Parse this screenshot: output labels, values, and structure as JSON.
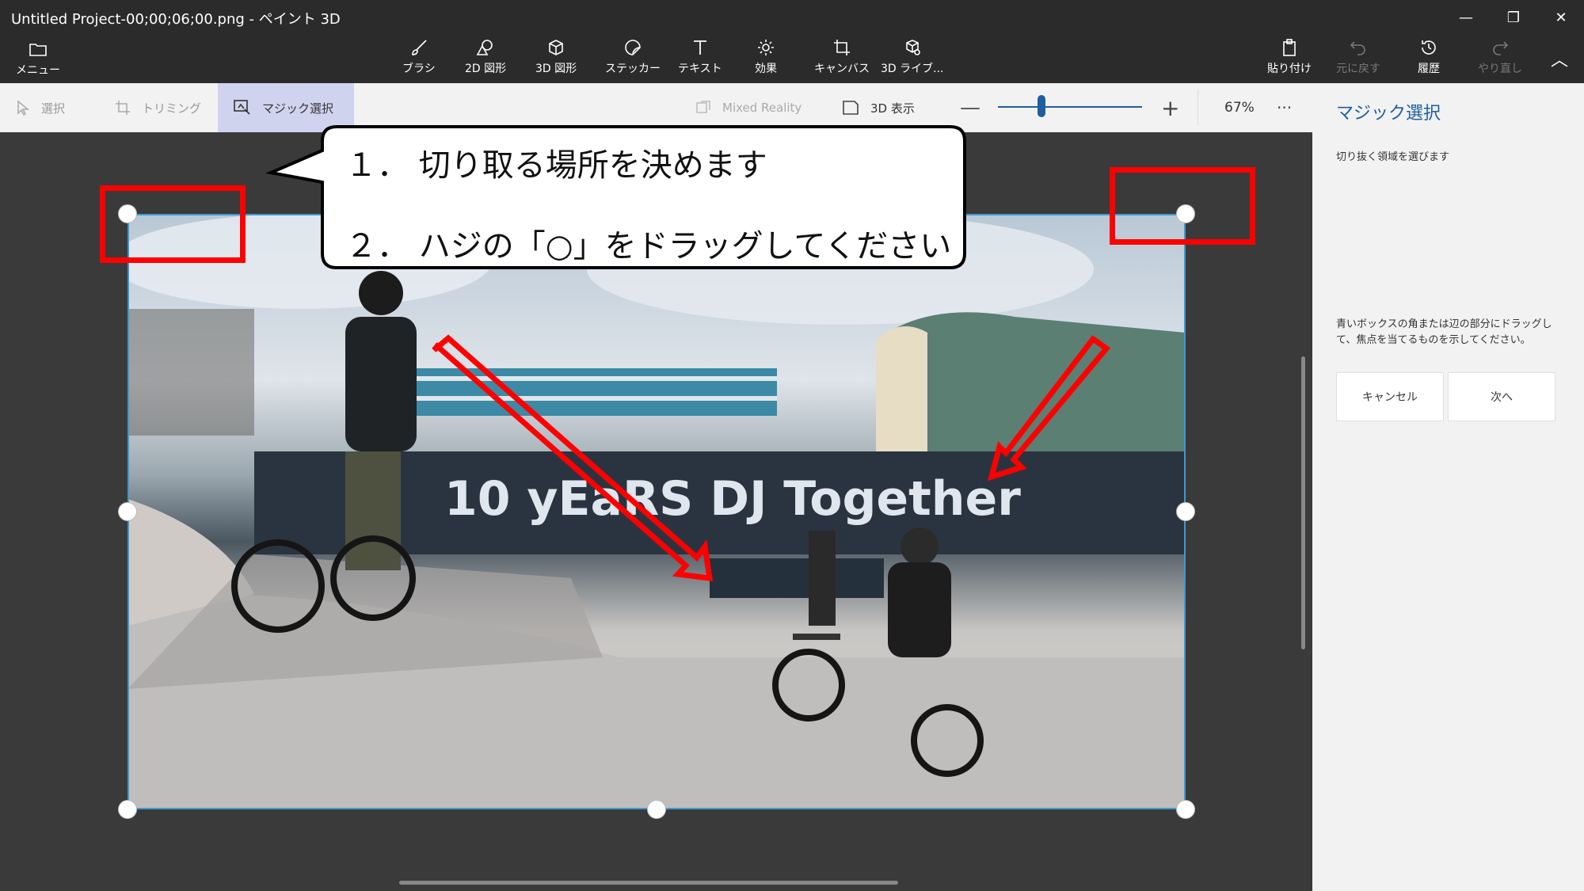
{
  "window": {
    "title": "Untitled Project-00;00;06;00.png - ペイント 3D",
    "minimize": "—",
    "restore": "❐",
    "close": "✕"
  },
  "ribbon": {
    "menu": "メニュー",
    "tools": [
      {
        "label": "ブラシ"
      },
      {
        "label": "2D 図形"
      },
      {
        "label": "3D 図形"
      },
      {
        "label": "ステッカー"
      },
      {
        "label": "テキスト"
      },
      {
        "label": "効果"
      },
      {
        "label": "キャンバス"
      },
      {
        "label": "3D ライブ..."
      }
    ],
    "right_tools": [
      {
        "label": "貼り付け"
      },
      {
        "label": "元に戻す"
      },
      {
        "label": "履歴"
      },
      {
        "label": "やり直し"
      }
    ],
    "collapse": "︿"
  },
  "subbar": {
    "select": "選択",
    "trim": "トリミング",
    "magic": "マジック選択",
    "mixed_reality": "Mixed Reality",
    "view3d": "3D 表示",
    "zoom_minus": "—",
    "zoom_plus": "+",
    "zoom_value": "67%",
    "zoom_fraction": 0.3,
    "more": "···"
  },
  "panel": {
    "title": "マジック選択",
    "subtitle": "切り抜く領域を選びます",
    "instruction": "青いボックスの角または辺の部分にドラッグして、焦点を当てるものを示してください。",
    "cancel": "キャンセル",
    "next": "次へ"
  },
  "callout": {
    "line1": "１． 切り取る場所を決めます",
    "line2": "２． ハジの「○」をドラッグしてください"
  },
  "colors": {
    "accent": "#1d5fa0",
    "annotation_red": "#ff0000",
    "selection_blue": "#3c9ad0"
  }
}
